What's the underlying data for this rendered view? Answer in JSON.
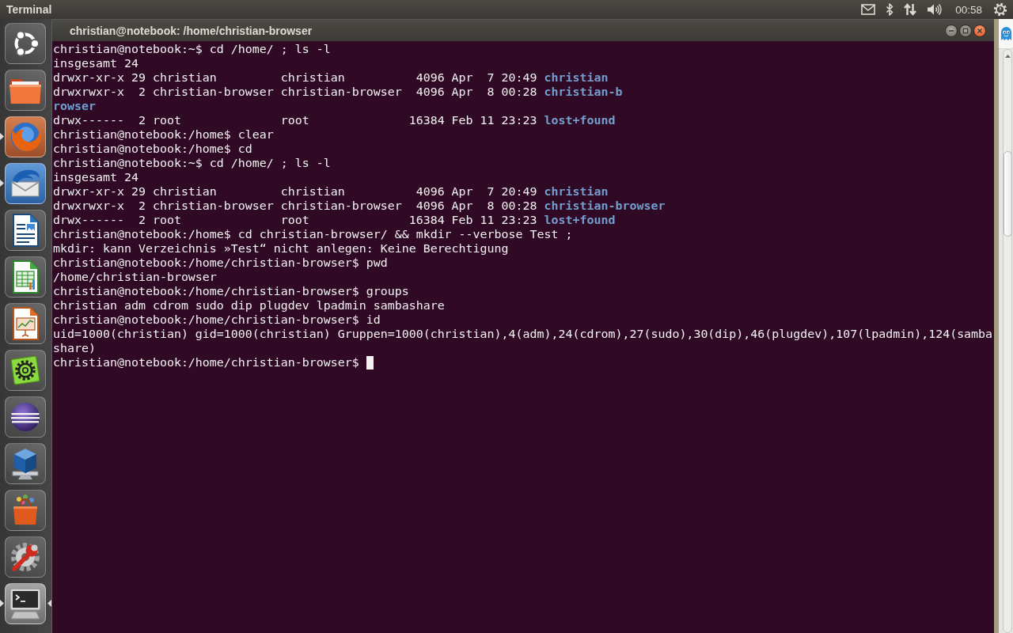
{
  "top_panel": {
    "app_title": "Terminal",
    "clock": "00:58"
  },
  "launcher": {
    "items": [
      {
        "kind": "dash",
        "running": false,
        "focused": false
      },
      {
        "kind": "files",
        "running": false,
        "focused": false
      },
      {
        "kind": "browser",
        "running": true,
        "focused": false
      },
      {
        "kind": "mail",
        "running": true,
        "focused": false
      },
      {
        "kind": "writer",
        "running": false,
        "focused": false
      },
      {
        "kind": "calc",
        "running": false,
        "focused": false
      },
      {
        "kind": "impress",
        "running": false,
        "focused": false
      },
      {
        "kind": "updater",
        "running": false,
        "focused": false
      },
      {
        "kind": "ide",
        "running": false,
        "focused": false
      },
      {
        "kind": "vm",
        "running": false,
        "focused": false
      },
      {
        "kind": "store",
        "running": false,
        "focused": false
      },
      {
        "kind": "settings",
        "running": false,
        "focused": false
      },
      {
        "kind": "terminal",
        "running": true,
        "focused": true
      }
    ]
  },
  "window": {
    "title": "christian@notebook: /home/christian-browser"
  },
  "terminal": {
    "cursor": true,
    "lines": [
      [
        {
          "kind": "text",
          "text": "christian@notebook:~$ cd /home/ ; ls -l"
        }
      ],
      [
        {
          "kind": "text",
          "text": "insgesamt 24"
        }
      ],
      [
        {
          "kind": "text",
          "text": "drwxr-xr-x 29 christian         christian          4096 Apr  7 20:49 "
        },
        {
          "kind": "directory",
          "text": "christian"
        }
      ],
      [
        {
          "kind": "text",
          "text": "drwxrwxr-x  2 christian-browser christian-browser  4096 Apr  8 00:28 "
        },
        {
          "kind": "directory",
          "text": "christian-b"
        }
      ],
      [
        {
          "kind": "directory",
          "text": "rowser"
        }
      ],
      [
        {
          "kind": "text",
          "text": "drwx------  2 root              root              16384 Feb 11 23:23 "
        },
        {
          "kind": "directory",
          "text": "lost+found"
        }
      ],
      [
        {
          "kind": "text",
          "text": "christian@notebook:/home$ clear"
        }
      ],
      [
        {
          "kind": "text",
          "text": "christian@notebook:/home$ cd"
        }
      ],
      [
        {
          "kind": "text",
          "text": "christian@notebook:~$ cd /home/ ; ls -l"
        }
      ],
      [
        {
          "kind": "text",
          "text": "insgesamt 24"
        }
      ],
      [
        {
          "kind": "text",
          "text": "drwxr-xr-x 29 christian         christian          4096 Apr  7 20:49 "
        },
        {
          "kind": "directory",
          "text": "christian"
        }
      ],
      [
        {
          "kind": "text",
          "text": "drwxrwxr-x  2 christian-browser christian-browser  4096 Apr  8 00:28 "
        },
        {
          "kind": "directory",
          "text": "christian-browser"
        }
      ],
      [
        {
          "kind": "text",
          "text": "drwx------  2 root              root              16384 Feb 11 23:23 "
        },
        {
          "kind": "directory",
          "text": "lost+found"
        }
      ],
      [
        {
          "kind": "text",
          "text": "christian@notebook:/home$ cd christian-browser/ && mkdir --verbose Test ;"
        }
      ],
      [
        {
          "kind": "text",
          "text": "mkdir: kann Verzeichnis »Test“ nicht anlegen: Keine Berechtigung"
        }
      ],
      [
        {
          "kind": "text",
          "text": "christian@notebook:/home/christian-browser$ pwd"
        }
      ],
      [
        {
          "kind": "text",
          "text": "/home/christian-browser"
        }
      ],
      [
        {
          "kind": "text",
          "text": "christian@notebook:/home/christian-browser$ groups"
        }
      ],
      [
        {
          "kind": "text",
          "text": "christian adm cdrom sudo dip plugdev lpadmin sambashare"
        }
      ],
      [
        {
          "kind": "text",
          "text": "christian@notebook:/home/christian-browser$ id"
        }
      ],
      [
        {
          "kind": "text",
          "text": "uid=1000(christian) gid=1000(christian) Gruppen=1000(christian),4(adm),24(cdrom),27(sudo),30(dip),46(plugdev),107(lpadmin),124(samba"
        }
      ],
      [
        {
          "kind": "text",
          "text": "share)"
        }
      ],
      [
        {
          "kind": "text",
          "text": "christian@notebook:/home/christian-browser$ "
        }
      ]
    ]
  }
}
